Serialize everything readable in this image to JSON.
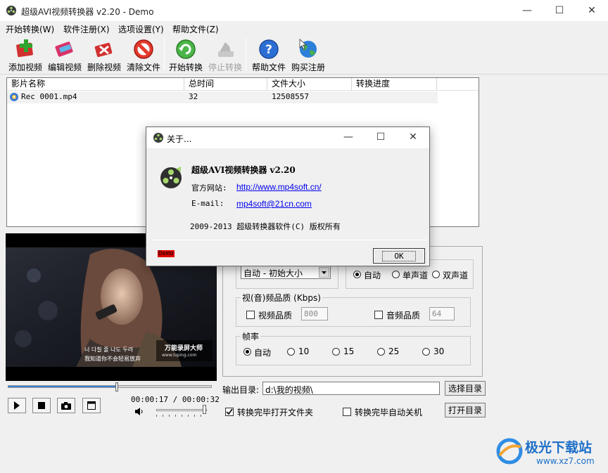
{
  "window": {
    "title": "超级AVI视频转换器 v2.20 - Demo",
    "minimize": "—",
    "maximize": "☐",
    "close": "✕"
  },
  "menu": [
    "开始转换(W)",
    "软件注册(X)",
    "选项设置(Y)",
    "帮助文件(Z)"
  ],
  "toolbar": {
    "add": "添加视频",
    "edit": "编辑视频",
    "delete": "删除视频",
    "clear": "清除文件",
    "start": "开始转换",
    "stop": "停止转换",
    "help": "帮助文件",
    "buy": "购买注册"
  },
  "filelist": {
    "columns": [
      "影片名称",
      "总时间",
      "文件大小",
      "转换进度"
    ],
    "rows": [
      {
        "name": "Rec 0001.mp4",
        "duration": "32",
        "size": "12508557",
        "progress": ""
      }
    ]
  },
  "preview": {
    "subtitle_line1": "너 다칠 줄 나도 두려",
    "subtitle_line2": "我知道你不会轻易放弃",
    "logo_title": "万能录屏大师",
    "logo_url": "www.luping.com"
  },
  "player": {
    "time": "00:00:17 / 00:00:32",
    "seek_fraction": 0.53
  },
  "settings": {
    "size_combo": "自动 - 初始大小",
    "channels": [
      "自动",
      "单声道",
      "双声道"
    ],
    "quality_group": "视(音)频品质 (Kbps)",
    "video_quality_label": "视频品质",
    "video_quality_value": "800",
    "audio_quality_label": "音频品质",
    "audio_quality_value": "64",
    "framerate_group": "帧率",
    "framerates": [
      "自动",
      "10",
      "15",
      "25",
      "30"
    ]
  },
  "output": {
    "label": "输出目录:",
    "path": "d:\\我的视频\\",
    "choose": "选择目录",
    "open": "打开目录",
    "open_folder_after": "转换完毕打开文件夹",
    "shutdown_after": "转换完毕自动关机"
  },
  "dialog": {
    "title": "关于...",
    "app_name": "超级AVI视频转换器 v2.20",
    "website_label": "官方网站:",
    "website": "http://www.mp4soft.cn/",
    "email_label": "E-mail:",
    "email": "mp4soft@21cn.com",
    "copyright": "2009-2013 超级转换器软件(C) 版权所有",
    "demo_badge": "Demo",
    "ok": "OK"
  },
  "watermark": {
    "text": "极光下载站",
    "url": "www.xz7.com"
  }
}
